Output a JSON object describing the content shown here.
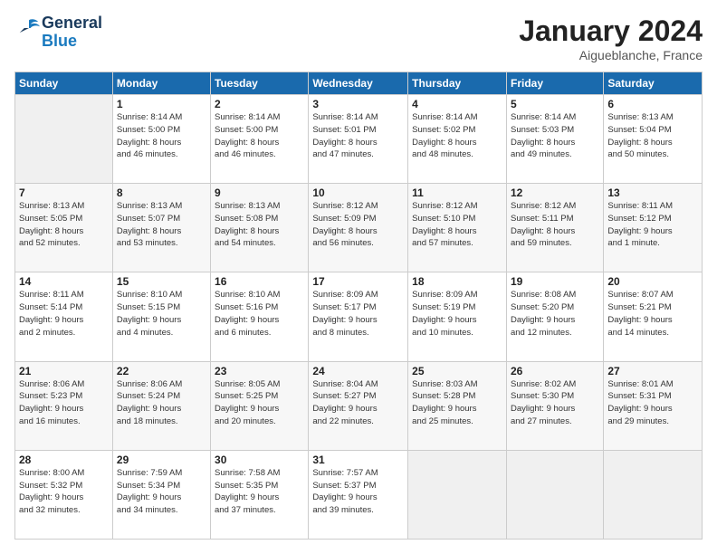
{
  "header": {
    "logo_line1": "General",
    "logo_line2": "Blue",
    "month": "January 2024",
    "location": "Aigueblanche, France"
  },
  "weekdays": [
    "Sunday",
    "Monday",
    "Tuesday",
    "Wednesday",
    "Thursday",
    "Friday",
    "Saturday"
  ],
  "weeks": [
    [
      {
        "day": "",
        "info": ""
      },
      {
        "day": "1",
        "info": "Sunrise: 8:14 AM\nSunset: 5:00 PM\nDaylight: 8 hours\nand 46 minutes."
      },
      {
        "day": "2",
        "info": "Sunrise: 8:14 AM\nSunset: 5:00 PM\nDaylight: 8 hours\nand 46 minutes."
      },
      {
        "day": "3",
        "info": "Sunrise: 8:14 AM\nSunset: 5:01 PM\nDaylight: 8 hours\nand 47 minutes."
      },
      {
        "day": "4",
        "info": "Sunrise: 8:14 AM\nSunset: 5:02 PM\nDaylight: 8 hours\nand 48 minutes."
      },
      {
        "day": "5",
        "info": "Sunrise: 8:14 AM\nSunset: 5:03 PM\nDaylight: 8 hours\nand 49 minutes."
      },
      {
        "day": "6",
        "info": "Sunrise: 8:13 AM\nSunset: 5:04 PM\nDaylight: 8 hours\nand 50 minutes."
      }
    ],
    [
      {
        "day": "7",
        "info": "Sunrise: 8:13 AM\nSunset: 5:05 PM\nDaylight: 8 hours\nand 52 minutes."
      },
      {
        "day": "8",
        "info": "Sunrise: 8:13 AM\nSunset: 5:07 PM\nDaylight: 8 hours\nand 53 minutes."
      },
      {
        "day": "9",
        "info": "Sunrise: 8:13 AM\nSunset: 5:08 PM\nDaylight: 8 hours\nand 54 minutes."
      },
      {
        "day": "10",
        "info": "Sunrise: 8:12 AM\nSunset: 5:09 PM\nDaylight: 8 hours\nand 56 minutes."
      },
      {
        "day": "11",
        "info": "Sunrise: 8:12 AM\nSunset: 5:10 PM\nDaylight: 8 hours\nand 57 minutes."
      },
      {
        "day": "12",
        "info": "Sunrise: 8:12 AM\nSunset: 5:11 PM\nDaylight: 8 hours\nand 59 minutes."
      },
      {
        "day": "13",
        "info": "Sunrise: 8:11 AM\nSunset: 5:12 PM\nDaylight: 9 hours\nand 1 minute."
      }
    ],
    [
      {
        "day": "14",
        "info": "Sunrise: 8:11 AM\nSunset: 5:14 PM\nDaylight: 9 hours\nand 2 minutes."
      },
      {
        "day": "15",
        "info": "Sunrise: 8:10 AM\nSunset: 5:15 PM\nDaylight: 9 hours\nand 4 minutes."
      },
      {
        "day": "16",
        "info": "Sunrise: 8:10 AM\nSunset: 5:16 PM\nDaylight: 9 hours\nand 6 minutes."
      },
      {
        "day": "17",
        "info": "Sunrise: 8:09 AM\nSunset: 5:17 PM\nDaylight: 9 hours\nand 8 minutes."
      },
      {
        "day": "18",
        "info": "Sunrise: 8:09 AM\nSunset: 5:19 PM\nDaylight: 9 hours\nand 10 minutes."
      },
      {
        "day": "19",
        "info": "Sunrise: 8:08 AM\nSunset: 5:20 PM\nDaylight: 9 hours\nand 12 minutes."
      },
      {
        "day": "20",
        "info": "Sunrise: 8:07 AM\nSunset: 5:21 PM\nDaylight: 9 hours\nand 14 minutes."
      }
    ],
    [
      {
        "day": "21",
        "info": "Sunrise: 8:06 AM\nSunset: 5:23 PM\nDaylight: 9 hours\nand 16 minutes."
      },
      {
        "day": "22",
        "info": "Sunrise: 8:06 AM\nSunset: 5:24 PM\nDaylight: 9 hours\nand 18 minutes."
      },
      {
        "day": "23",
        "info": "Sunrise: 8:05 AM\nSunset: 5:25 PM\nDaylight: 9 hours\nand 20 minutes."
      },
      {
        "day": "24",
        "info": "Sunrise: 8:04 AM\nSunset: 5:27 PM\nDaylight: 9 hours\nand 22 minutes."
      },
      {
        "day": "25",
        "info": "Sunrise: 8:03 AM\nSunset: 5:28 PM\nDaylight: 9 hours\nand 25 minutes."
      },
      {
        "day": "26",
        "info": "Sunrise: 8:02 AM\nSunset: 5:30 PM\nDaylight: 9 hours\nand 27 minutes."
      },
      {
        "day": "27",
        "info": "Sunrise: 8:01 AM\nSunset: 5:31 PM\nDaylight: 9 hours\nand 29 minutes."
      }
    ],
    [
      {
        "day": "28",
        "info": "Sunrise: 8:00 AM\nSunset: 5:32 PM\nDaylight: 9 hours\nand 32 minutes."
      },
      {
        "day": "29",
        "info": "Sunrise: 7:59 AM\nSunset: 5:34 PM\nDaylight: 9 hours\nand 34 minutes."
      },
      {
        "day": "30",
        "info": "Sunrise: 7:58 AM\nSunset: 5:35 PM\nDaylight: 9 hours\nand 37 minutes."
      },
      {
        "day": "31",
        "info": "Sunrise: 7:57 AM\nSunset: 5:37 PM\nDaylight: 9 hours\nand 39 minutes."
      },
      {
        "day": "",
        "info": ""
      },
      {
        "day": "",
        "info": ""
      },
      {
        "day": "",
        "info": ""
      }
    ]
  ]
}
